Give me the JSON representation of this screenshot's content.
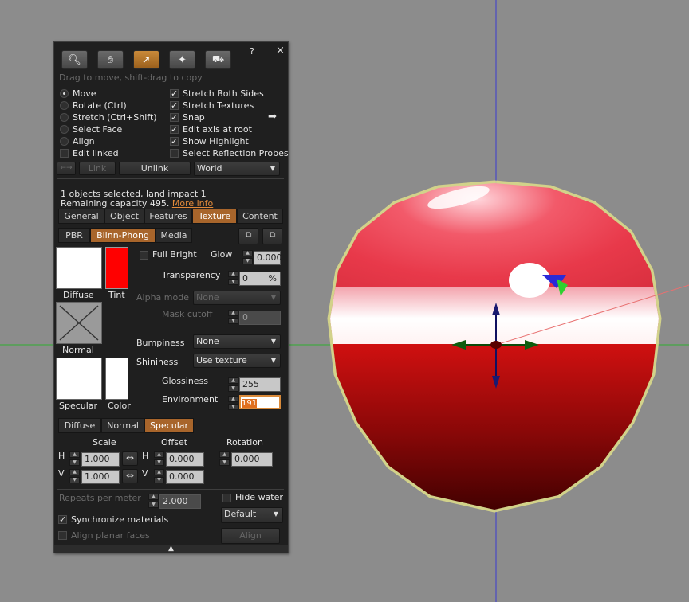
{
  "colors": {
    "background": "#8c8c8c",
    "panel": "#1f1f1f",
    "accent": "#a8652b",
    "tint": "#ff0000",
    "sphere": "#e8394a"
  },
  "toolbar": {
    "tools": [
      "zoom-tool",
      "grab-tool",
      "edit-tool",
      "create-tool",
      "land-tool"
    ],
    "help": "?",
    "close": "×"
  },
  "hint": "Drag to move, shift-drag to copy",
  "modes": [
    "Move",
    "Rotate (Ctrl)",
    "Stretch (Ctrl+Shift)",
    "Select Face",
    "Align"
  ],
  "edit_linked": "Edit linked",
  "options": [
    "Stretch Both Sides",
    "Stretch Textures",
    "Snap",
    "Edit axis at root",
    "Show Highlight"
  ],
  "select_reflection": "Select Reflection Probes",
  "link_row": {
    "arrows": "←→",
    "link": "Link",
    "unlink": "Unlink",
    "ruler": "World"
  },
  "selection": {
    "line1": "1 objects selected, land impact 1",
    "line2": "Remaining capacity 495.",
    "more_info": "More info"
  },
  "main_tabs": [
    "General",
    "Object",
    "Features",
    "Texture",
    "Content"
  ],
  "mat_tabs": [
    "PBR",
    "Blinn-Phong",
    "Media"
  ],
  "texture": {
    "diffuse": "Diffuse",
    "tint": "Tint",
    "normal": "Normal",
    "specular": "Specular",
    "color": "Color",
    "full_bright": "Full Bright",
    "glow": "Glow",
    "glow_value": "0.000",
    "transparency": "Transparency",
    "transparency_value": "0",
    "percent": "%",
    "alpha_mode": "Alpha mode",
    "alpha_value": "None",
    "mask_cutoff": "Mask cutoff",
    "mask_value": "0",
    "bumpiness": "Bumpiness",
    "bumpiness_value": "None",
    "shininess": "Shininess",
    "shininess_value": "Use texture",
    "glossiness": "Glossiness",
    "glossiness_value": "255",
    "environment": "Environment",
    "environment_value": "191"
  },
  "map_tabs": [
    "Diffuse",
    "Normal",
    "Specular"
  ],
  "mapping": {
    "scale": "Scale",
    "offset": "Offset",
    "rotation": "Rotation",
    "h": "H",
    "v": "V",
    "scale_h": "1.000",
    "scale_v": "1.000",
    "offset_h": "0.000",
    "offset_v": "0.000",
    "rotation_value": "0.000"
  },
  "bottom": {
    "repeats": "Repeats per meter",
    "repeats_value": "2.000",
    "hide_water": "Hide water",
    "default": "Default",
    "sync": "Synchronize materials",
    "align_planar": "Align planar faces",
    "align": "Align"
  }
}
